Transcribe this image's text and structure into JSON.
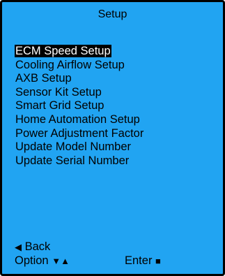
{
  "title": "Setup",
  "colors": {
    "background": "#21a4f2",
    "border": "#000000",
    "selected_bg": "#000000",
    "selected_fg": "#ffffff"
  },
  "menu": {
    "selected_index": 0,
    "items": [
      {
        "label": "ECM Speed Setup"
      },
      {
        "label": "Cooling Airflow Setup"
      },
      {
        "label": "AXB Setup"
      },
      {
        "label": "Sensor Kit Setup"
      },
      {
        "label": "Smart Grid Setup"
      },
      {
        "label": "Home Automation Setup"
      },
      {
        "label": "Power Adjustment Factor"
      },
      {
        "label": "Update Model Number"
      },
      {
        "label": "Update Serial Number"
      }
    ]
  },
  "footer": {
    "back_icon": "left-triangle-icon",
    "back_label": "Back",
    "option_label": "Option",
    "option_icons": [
      "down-triangle-icon",
      "up-triangle-icon"
    ],
    "enter_label": "Enter",
    "enter_icon": "square-icon"
  }
}
